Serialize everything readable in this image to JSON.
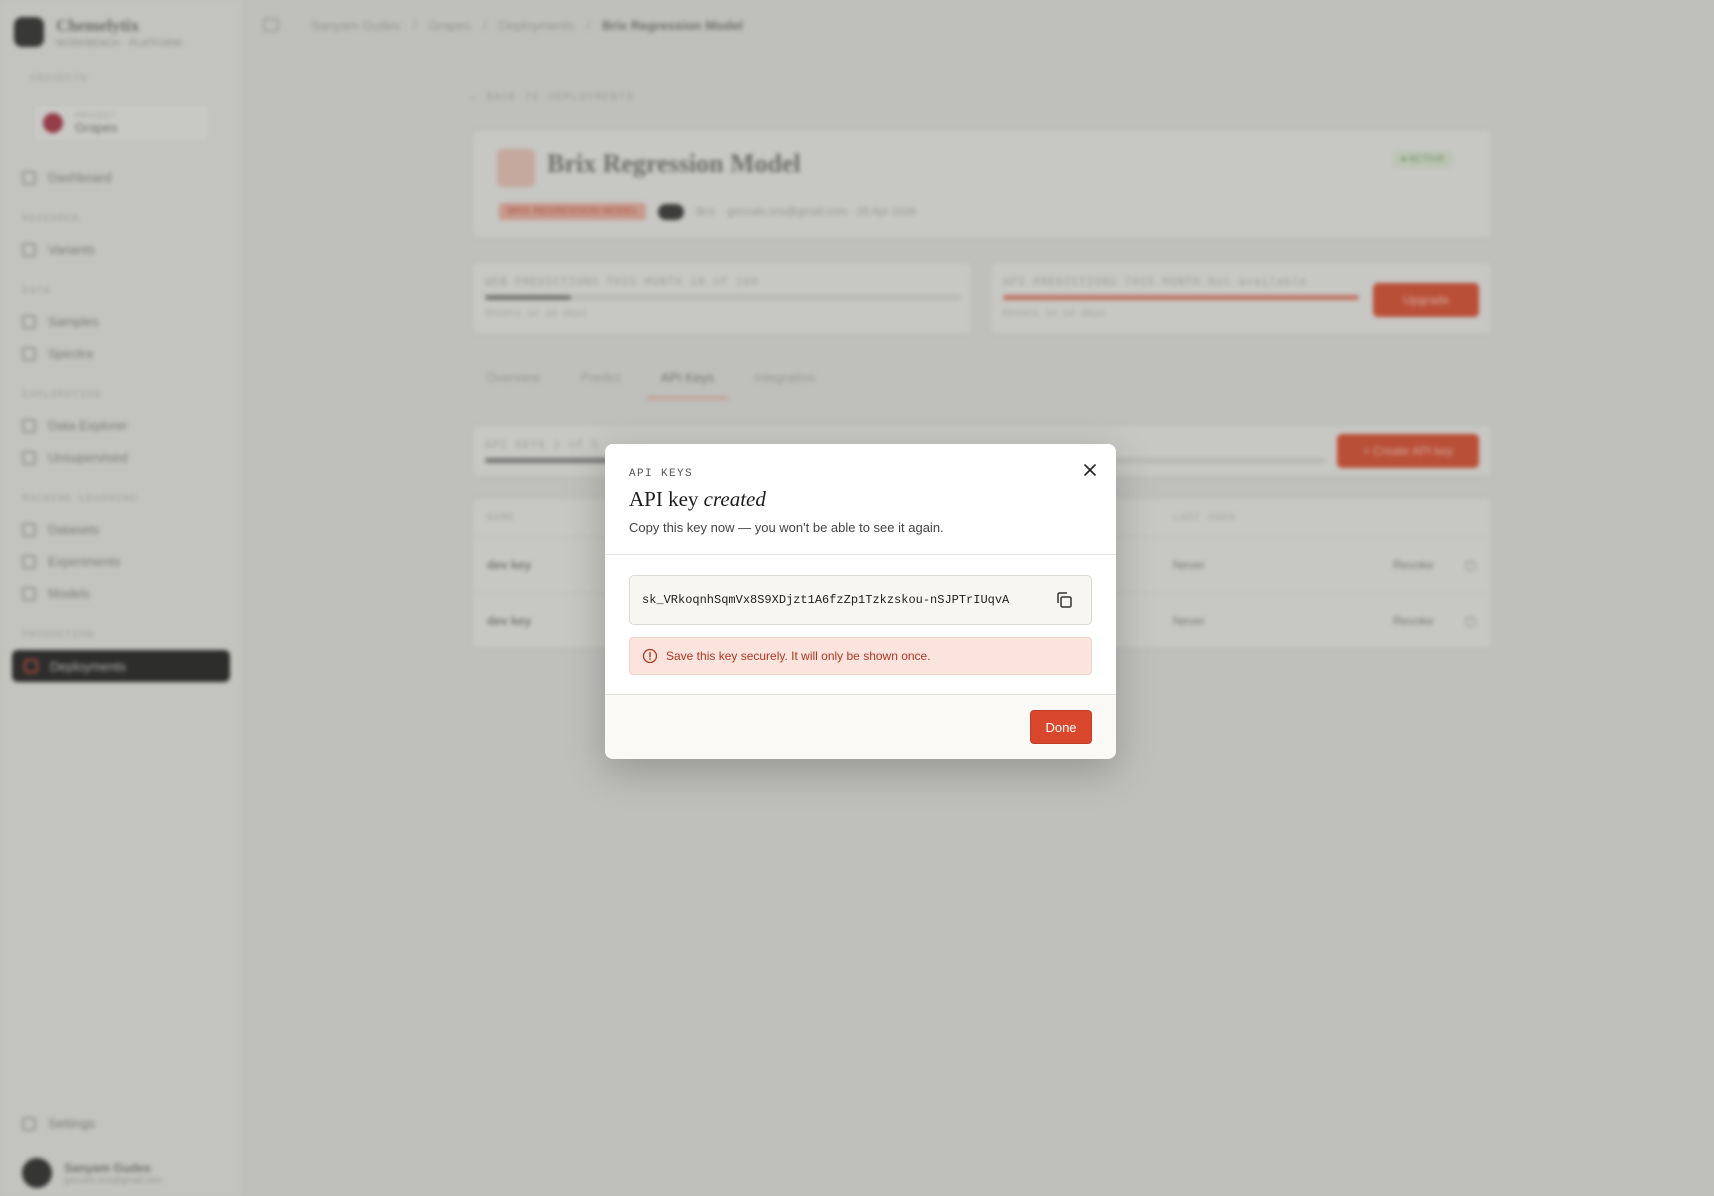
{
  "sidebar": {
    "brand_name": "Chemelytix",
    "brand_sub": "WORKBENCH · PLATFORM",
    "projects_label": "PROJECTS",
    "project_kicker": "PROJECT",
    "project_name": "Grapes",
    "dashboard": "Dashboard",
    "section_research": "RESEARCH",
    "item_variants": "Variants",
    "section_data": "DATA",
    "item_samples": "Samples",
    "item_spectra": "Spectra",
    "section_exploration": "EXPLORATION",
    "item_data_explorer": "Data Explorer",
    "item_unsupervised": "Unsupervised",
    "section_ml": "MACHINE LEARNING",
    "item_datasets": "Datasets",
    "item_experiments": "Experiments",
    "item_models": "Models",
    "section_production": "PRODUCTION",
    "item_deployments": "Deployments",
    "settings": "Settings",
    "user_name": "Sanyam Gudes",
    "user_email": "gonzalo.sns@gmail.com"
  },
  "topbar": {
    "crumb_org": "Sanyam Gudes",
    "crumb_project": "Grapes",
    "crumb_section": "Deployments",
    "crumb_current": "Brix Regression Model"
  },
  "page": {
    "back_link": "← BACK TO DEPLOYMENTS",
    "model_title": "Brix Regression Model",
    "status": "● ACTIVE",
    "model_tag": "BRIX REGRESSION MODEL",
    "target": "Brix",
    "meta": "gonzalo.sns@gmail.com · 28 Apr 2026",
    "stat1_label": "WEB PREDICTIONS THIS MONTH  18 of 100",
    "stat1_sub": "Resets in 14 days",
    "stat1_fill": 0.18,
    "stat2_label": "API PREDICTIONS THIS MONTH  Not available",
    "stat2_sub": "Resets in 14 days",
    "stat2_fill": 1.0,
    "upgrade_label": "Upgrade",
    "tabs": [
      "Overview",
      "Predict",
      "API Keys",
      "Integration"
    ],
    "keys_label": "API KEYS  2 of 5",
    "create_key_label": "+  Create API key",
    "table_headers": [
      "NAME",
      "LAST USED"
    ],
    "rows": [
      {
        "name": "dev key",
        "last_used": "Never",
        "action": "Revoke"
      },
      {
        "name": "dev key",
        "last_used": "Never",
        "action": "Revoke"
      }
    ]
  },
  "modal": {
    "kicker": "API KEYS",
    "title_plain": "API key",
    "title_italic": "created",
    "description": "Copy this key now — you won't be able to see it again.",
    "key_value": "sk_VRkoqnhSqmVx8S9XDjzt1A6fzZp1Tzkzskou-nSJPTrIUqvA",
    "warning": "Save this key securely. It will only be shown once.",
    "done_label": "Done"
  },
  "colors": {
    "accent": "#d9482d",
    "warning_bg": "#fce4de",
    "warning_text": "#b0371f"
  }
}
